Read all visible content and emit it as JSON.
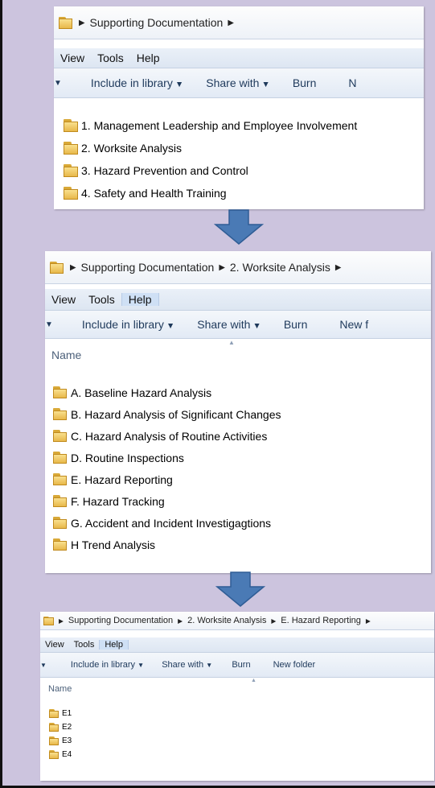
{
  "colors": {
    "background": "#ccc4de",
    "arrow": "#4a7ab5",
    "folder": "#e8b84a"
  },
  "window1": {
    "breadcrumb": [
      "Supporting Documentation"
    ],
    "menu": [
      "View",
      "Tools",
      "Help"
    ],
    "commands": [
      "Include in library",
      "Share with",
      "Burn",
      "N"
    ],
    "items": [
      "1. Management Leadership and Employee Involvement",
      "2. Worksite Analysis",
      "3. Hazard Prevention and Control",
      "4. Safety and Health Training"
    ]
  },
  "window2": {
    "breadcrumb": [
      "Supporting Documentation",
      "2. Worksite Analysis"
    ],
    "menu": [
      "View",
      "Tools",
      "Help"
    ],
    "commands": [
      "Include in library",
      "Share with",
      "Burn",
      "New f"
    ],
    "column_header": "Name",
    "items": [
      "A. Baseline Hazard Analysis",
      "B. Hazard Analysis of Significant Changes",
      "C. Hazard Analysis of Routine Activities",
      "D. Routine Inspections",
      "E. Hazard Reporting",
      "F. Hazard Tracking",
      "G. Accident and Incident Investigagtions",
      "H Trend Analysis"
    ]
  },
  "window3": {
    "breadcrumb": [
      "Supporting Documentation",
      "2. Worksite Analysis",
      "E. Hazard Reporting"
    ],
    "menu": [
      "View",
      "Tools",
      "Help"
    ],
    "commands": [
      "Include in library",
      "Share with",
      "Burn",
      "New folder"
    ],
    "column_header": "Name",
    "items": [
      "E1",
      "E2",
      "E3",
      "E4"
    ]
  }
}
